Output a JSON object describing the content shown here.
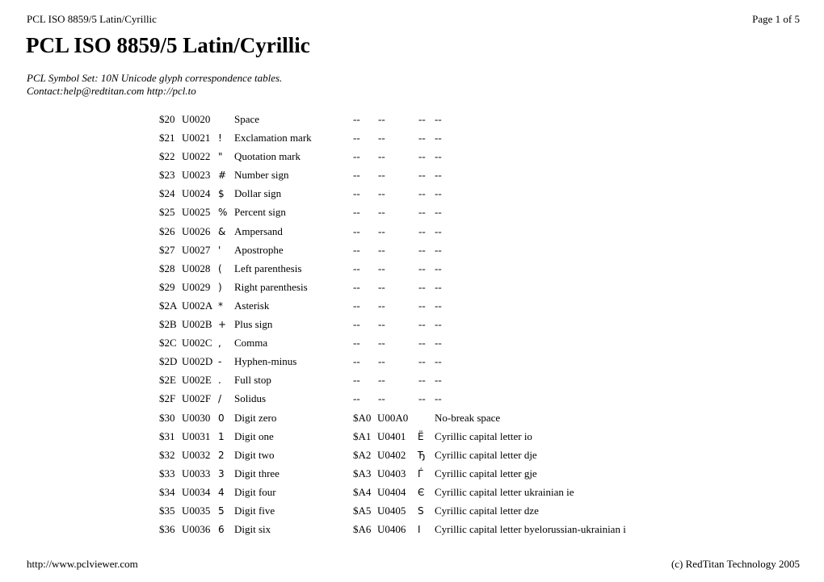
{
  "header": {
    "left": "PCL ISO 8859/5 Latin/Cyrillic",
    "right": "Page 1 of 5"
  },
  "title": "PCL ISO 8859/5 Latin/Cyrillic",
  "subtitle": {
    "line1": "PCL Symbol Set: 10N Unicode glyph correspondence tables.",
    "line2": "Contact:help@redtitan.com http://pcl.to"
  },
  "rows": [
    {
      "code": "$20",
      "unicode": "U0020",
      "glyph": " ",
      "name": "Space",
      "code2": "--",
      "unicode2": "--",
      "glyph2": "--",
      "name2": "--"
    },
    {
      "code": "$21",
      "unicode": "U0021",
      "glyph": "!",
      "name": "Exclamation mark",
      "code2": "--",
      "unicode2": "--",
      "glyph2": "--",
      "name2": "--"
    },
    {
      "code": "$22",
      "unicode": "U0022",
      "glyph": "\"",
      "name": "Quotation mark",
      "code2": "--",
      "unicode2": "--",
      "glyph2": "--",
      "name2": "--"
    },
    {
      "code": "$23",
      "unicode": "U0023",
      "glyph": "#",
      "name": "Number sign",
      "code2": "--",
      "unicode2": "--",
      "glyph2": "--",
      "name2": "--"
    },
    {
      "code": "$24",
      "unicode": "U0024",
      "glyph": "$",
      "name": "Dollar sign",
      "code2": "--",
      "unicode2": "--",
      "glyph2": "--",
      "name2": "--"
    },
    {
      "code": "$25",
      "unicode": "U0025",
      "glyph": "%",
      "name": "Percent sign",
      "code2": "--",
      "unicode2": "--",
      "glyph2": "--",
      "name2": "--"
    },
    {
      "code": "$26",
      "unicode": "U0026",
      "glyph": "&",
      "name": "Ampersand",
      "code2": "--",
      "unicode2": "--",
      "glyph2": "--",
      "name2": "--"
    },
    {
      "code": "$27",
      "unicode": "U0027",
      "glyph": "'",
      "name": "Apostrophe",
      "code2": "--",
      "unicode2": "--",
      "glyph2": "--",
      "name2": "--"
    },
    {
      "code": "$28",
      "unicode": "U0028",
      "glyph": "(",
      "name": "Left parenthesis",
      "code2": "--",
      "unicode2": "--",
      "glyph2": "--",
      "name2": "--"
    },
    {
      "code": "$29",
      "unicode": "U0029",
      "glyph": ")",
      "name": "Right parenthesis",
      "code2": "--",
      "unicode2": "--",
      "glyph2": "--",
      "name2": "--"
    },
    {
      "code": "$2A",
      "unicode": "U002A",
      "glyph": "*",
      "name": "Asterisk",
      "code2": "--",
      "unicode2": "--",
      "glyph2": "--",
      "name2": "--"
    },
    {
      "code": "$2B",
      "unicode": "U002B",
      "glyph": "+",
      "name": "Plus sign",
      "code2": "--",
      "unicode2": "--",
      "glyph2": "--",
      "name2": "--"
    },
    {
      "code": "$2C",
      "unicode": "U002C",
      "glyph": ",",
      "name": "Comma",
      "code2": "--",
      "unicode2": "--",
      "glyph2": "--",
      "name2": "--"
    },
    {
      "code": "$2D",
      "unicode": "U002D",
      "glyph": "-",
      "name": "Hyphen-minus",
      "code2": "--",
      "unicode2": "--",
      "glyph2": "--",
      "name2": "--"
    },
    {
      "code": "$2E",
      "unicode": "U002E",
      "glyph": ".",
      "name": "Full stop",
      "code2": "--",
      "unicode2": "--",
      "glyph2": "--",
      "name2": "--"
    },
    {
      "code": "$2F",
      "unicode": "U002F",
      "glyph": "/",
      "name": "Solidus",
      "code2": "--",
      "unicode2": "--",
      "glyph2": "--",
      "name2": "--"
    },
    {
      "code": "$30",
      "unicode": "U0030",
      "glyph": "0",
      "name": "Digit zero",
      "code2": "$A0",
      "unicode2": "U00A0",
      "glyph2": " ",
      "name2": "No-break space"
    },
    {
      "code": "$31",
      "unicode": "U0031",
      "glyph": "1",
      "name": "Digit one",
      "code2": "$A1",
      "unicode2": "U0401",
      "glyph2": "Ё",
      "name2": "Cyrillic capital letter io"
    },
    {
      "code": "$32",
      "unicode": "U0032",
      "glyph": "2",
      "name": "Digit two",
      "code2": "$A2",
      "unicode2": "U0402",
      "glyph2": "Ђ",
      "name2": "Cyrillic capital letter dje"
    },
    {
      "code": "$33",
      "unicode": "U0033",
      "glyph": "3",
      "name": "Digit three",
      "code2": "$A3",
      "unicode2": "U0403",
      "glyph2": "Ѓ",
      "name2": "Cyrillic capital letter gje"
    },
    {
      "code": "$34",
      "unicode": "U0034",
      "glyph": "4",
      "name": "Digit four",
      "code2": "$A4",
      "unicode2": "U0404",
      "glyph2": "Є",
      "name2": "Cyrillic capital letter ukrainian ie"
    },
    {
      "code": "$35",
      "unicode": "U0035",
      "glyph": "5",
      "name": "Digit five",
      "code2": "$A5",
      "unicode2": "U0405",
      "glyph2": "Ѕ",
      "name2": "Cyrillic capital letter dze"
    },
    {
      "code": "$36",
      "unicode": "U0036",
      "glyph": "6",
      "name": "Digit six",
      "code2": "$A6",
      "unicode2": "U0406",
      "glyph2": "І",
      "name2": "Cyrillic capital letter byelorussian-ukrainian i"
    }
  ],
  "footer": {
    "left": "http://www.pclviewer.com",
    "right": "(c) RedTitan Technology 2005"
  }
}
